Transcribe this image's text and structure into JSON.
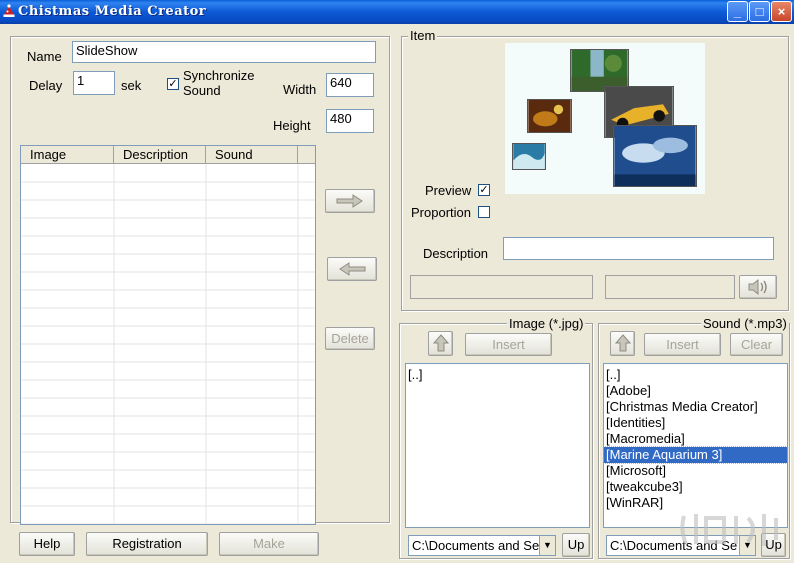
{
  "window": {
    "title": "Chistmas Media Creator",
    "minimize": "_",
    "maximize": "□",
    "close": "×"
  },
  "left": {
    "name_label": "Name",
    "name_value": "SlideShow",
    "delay_label": "Delay",
    "delay_value": "1",
    "delay_unit": "sek",
    "sync_label_1": "Synchronize",
    "sync_label_2": "Sound",
    "sync_checked": "✓",
    "width_label": "Width",
    "width_value": "640",
    "height_label": "Height",
    "height_value": "480",
    "columns": [
      "Image",
      "Description",
      "Sound"
    ],
    "move_right_icon": "arrow-right-icon",
    "move_left_icon": "arrow-left-icon",
    "delete_label": "Delete"
  },
  "bottom_buttons": {
    "help": "Help",
    "registration": "Registration",
    "make": "Make"
  },
  "item": {
    "group_title": "Item",
    "preview_label": "Preview",
    "preview_checked": "✓",
    "proportion_label": "Proportion",
    "description_label": "Description",
    "description_value": ""
  },
  "image_panel": {
    "title": "Image  (*.jpg)",
    "insert_label": "Insert",
    "items": [
      "[..]"
    ],
    "path": "C:\\Documents and Se",
    "up_label": "Up"
  },
  "sound_panel": {
    "title": "Sound (*.mp3)",
    "insert_label": "Insert",
    "clear_label": "Clear",
    "items": [
      "[..]",
      "[Adobe]",
      "[Christmas Media Creator]",
      "[Identities]",
      "[Macromedia]",
      "[Marine Aquarium 3]",
      "[Microsoft]",
      "[tweakcube3]",
      "[WinRAR]"
    ],
    "selected_index": 5,
    "path": "C:\\Documents and Se",
    "up_label": "Up"
  },
  "colors": {
    "titlebar": "#0a5fd8",
    "selection": "#316ac5",
    "window_bg": "#ece9d8"
  }
}
